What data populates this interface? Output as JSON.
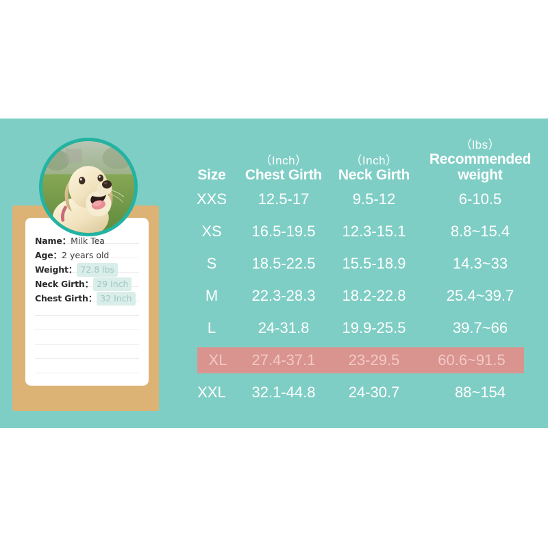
{
  "banner": {
    "background_color": "#7fcec5"
  },
  "pet_card": {
    "board_color": "#dcb275",
    "paper_color": "#ffffff",
    "photo": {
      "icon": "dog-photo",
      "alt": "yellow labrador retriever on grass",
      "ring_color": "#22b3a3"
    },
    "fields": [
      {
        "label": "Name",
        "colon": "：",
        "value": "Milk Tea",
        "highlighted": false
      },
      {
        "label": "Age",
        "colon": "：",
        "value": "2 years old",
        "highlighted": false
      },
      {
        "label": "Weight",
        "colon": "：",
        "value": "72.8 lbs",
        "highlighted": true
      },
      {
        "label": "Neck Girth",
        "colon": "：",
        "value": "29 Inch",
        "highlighted": true
      },
      {
        "label": "Chest Girth",
        "colon": "：",
        "value": "32 Inch",
        "highlighted": true
      }
    ],
    "highlight_bg": "#d9ede9",
    "highlight_text": "#9fc8c2"
  },
  "size_table": {
    "headers": [
      {
        "unit": "",
        "name": "Size"
      },
      {
        "unit": "（Inch）",
        "name": "Chest Girth"
      },
      {
        "unit": "（Inch）",
        "name": "Neck Girth"
      },
      {
        "unit": "（lbs）",
        "name": "Recommended weight"
      }
    ],
    "highlight_row_index": 5,
    "highlight_color": "#d9948f",
    "highlight_text_color": "#f2c9c6",
    "text_color": "#ffffff",
    "rows": [
      {
        "size": "XXS",
        "chest": "12.5-17",
        "neck": "9.5-12",
        "weight": "6-10.5"
      },
      {
        "size": "XS",
        "chest": "16.5-19.5",
        "neck": "12.3-15.1",
        "weight": "8.8~15.4"
      },
      {
        "size": "S",
        "chest": "18.5-22.5",
        "neck": "15.5-18.9",
        "weight": "14.3~33"
      },
      {
        "size": "M",
        "chest": "22.3-28.3",
        "neck": "18.2-22.8",
        "weight": "25.4~39.7"
      },
      {
        "size": "L",
        "chest": "24-31.8",
        "neck": "19.9-25.5",
        "weight": "39.7~66"
      },
      {
        "size": "XL",
        "chest": "27.4-37.1",
        "neck": "23-29.5",
        "weight": "60.6~91.5"
      },
      {
        "size": "XXL",
        "chest": "32.1-44.8",
        "neck": "24-30.7",
        "weight": "88~154"
      }
    ]
  }
}
